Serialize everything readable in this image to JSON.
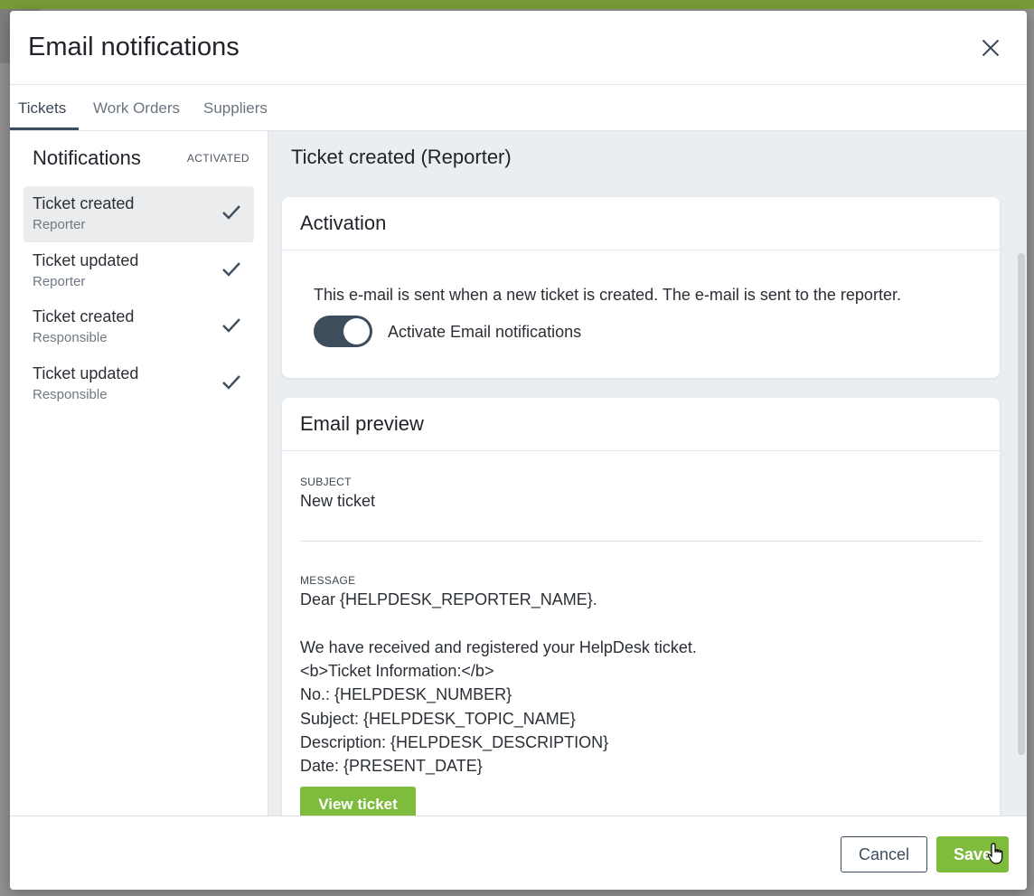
{
  "modal": {
    "title": "Email notifications"
  },
  "tabs": [
    {
      "label": "Tickets",
      "active": true
    },
    {
      "label": "Work Orders",
      "active": false
    },
    {
      "label": "Suppliers",
      "active": false
    }
  ],
  "sidebar": {
    "title": "Notifications",
    "column_label": "ACTIVATED",
    "items": [
      {
        "title": "Ticket created",
        "subtitle": "Reporter",
        "activated": true,
        "selected": true
      },
      {
        "title": "Ticket updated",
        "subtitle": "Reporter",
        "activated": true,
        "selected": false
      },
      {
        "title": "Ticket created",
        "subtitle": "Responsible",
        "activated": true,
        "selected": false
      },
      {
        "title": "Ticket updated",
        "subtitle": "Responsible",
        "activated": true,
        "selected": false
      }
    ]
  },
  "content": {
    "title": "Ticket created (Reporter)",
    "activation": {
      "title": "Activation",
      "description": "This e-mail is sent when a new ticket is created. The e-mail is sent to the reporter.",
      "toggle_label": "Activate Email notifications",
      "toggle_on": true
    },
    "preview": {
      "title": "Email preview",
      "subject_label": "SUBJECT",
      "subject": "New ticket",
      "message_label": "MESSAGE",
      "message_lines": [
        "Dear {HELPDESK_REPORTER_NAME}.",
        "",
        "We have received and registered your HelpDesk ticket.",
        "<b>Ticket Information:</b>",
        "No.: {HELPDESK_NUMBER}",
        "Subject: {HELPDESK_TOPIC_NAME}",
        "Description: {HELPDESK_DESCRIPTION}",
        "Date: {PRESENT_DATE}"
      ],
      "view_button": "View ticket"
    }
  },
  "footer": {
    "cancel_label": "Cancel",
    "save_label": "Save"
  },
  "colors": {
    "accent_green": "#7fbb3c",
    "dark_slate": "#3e4d5c",
    "top_bar": "#7a9a3a"
  }
}
